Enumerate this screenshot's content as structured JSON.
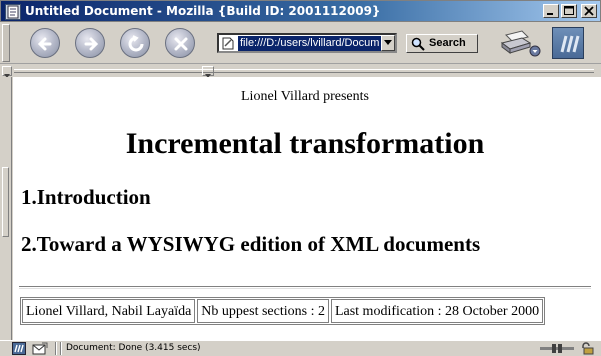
{
  "window": {
    "title": "Untitled Document - Mozilla {Build ID: 2001112009}"
  },
  "toolbar": {
    "url": "file:///D:/users/lvillard/Docum",
    "search_label": "Search"
  },
  "document": {
    "presents": "Lionel Villard presents",
    "title": "Incremental transformation",
    "sections": [
      "1.Introduction",
      "2.Toward a WYSIWYG edition of XML documents"
    ],
    "footer": [
      "Lionel Villard, Nabil Layaïda",
      "Nb uppest sections : 2",
      "Last modification : 28 October 2000"
    ]
  },
  "status": {
    "text": "Document: Done (3.415 secs)"
  }
}
